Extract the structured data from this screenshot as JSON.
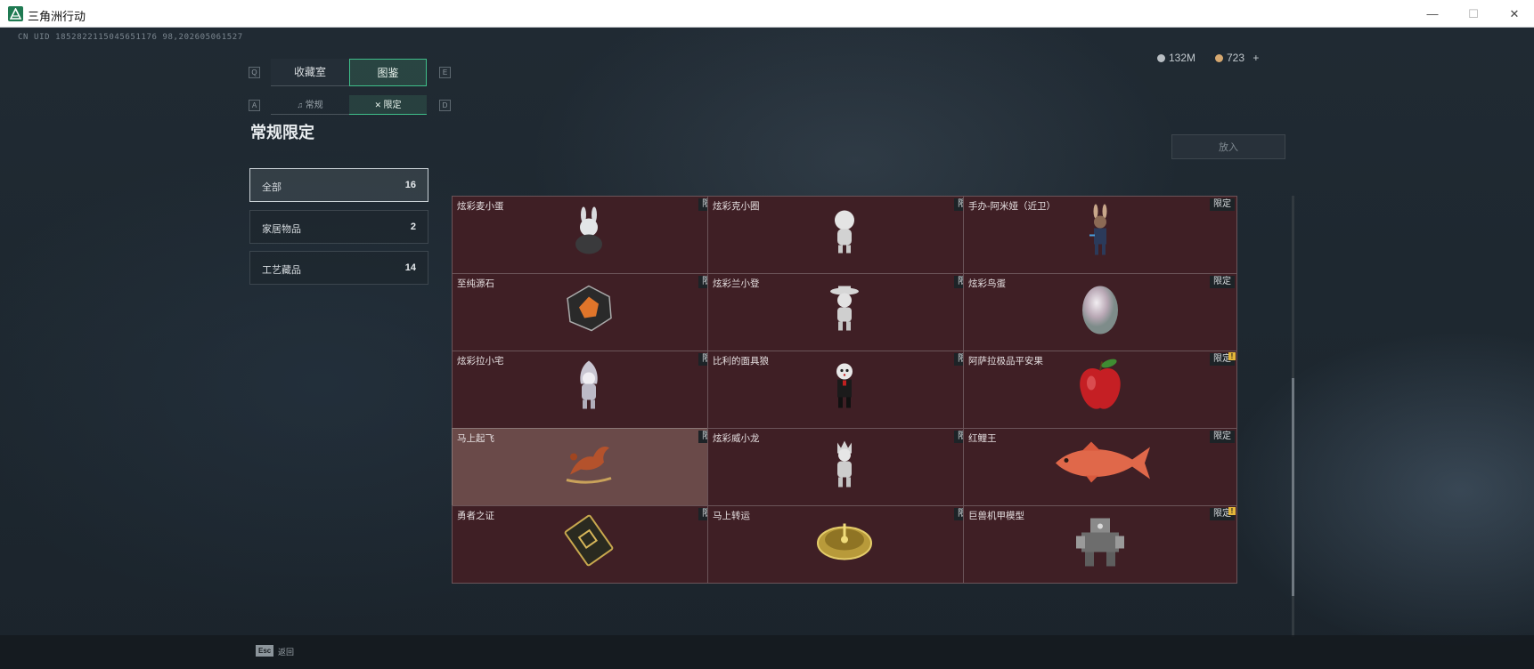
{
  "window": {
    "title": "三角洲行动",
    "minimize": "—",
    "maximize": "☐",
    "close": "✕"
  },
  "uid_text": "CN UID 1852822115045651176 98,202605061527",
  "tabs": {
    "left_key": "Q",
    "right_key": "E",
    "collection": "收藏室",
    "catalog": "图鉴"
  },
  "subtabs": {
    "left_key": "A",
    "right_key": "D",
    "regular": "常规",
    "limited": "限定"
  },
  "section_title": "常规限定",
  "categories": [
    {
      "label": "全部",
      "count": "16"
    },
    {
      "label": "家居物品",
      "count": "2"
    },
    {
      "label": "工艺藏品",
      "count": "14"
    }
  ],
  "currency": {
    "first": "132M",
    "second": "723",
    "add": "+"
  },
  "put_in_button": "放入",
  "limited_tag": "限定",
  "new_mark": "!",
  "items": [
    {
      "name": "炫彩麦小蛋",
      "icon": "rabbit-egg-figure-icon",
      "new": false
    },
    {
      "name": "炫彩克小圈",
      "icon": "girl-figure-icon",
      "new": false
    },
    {
      "name": "手办-阿米娅（近卫）",
      "icon": "amiya-figure-icon",
      "new": false
    },
    {
      "name": "至纯源石",
      "icon": "orange-crystal-icon",
      "new": true
    },
    {
      "name": "炫彩兰小登",
      "icon": "sombrero-figure-icon",
      "new": false
    },
    {
      "name": "炫彩鸟蛋",
      "icon": "egg-icon",
      "new": false
    },
    {
      "name": "炫彩拉小宅",
      "icon": "hooded-figure-icon",
      "new": true
    },
    {
      "name": "比利的面具狼",
      "icon": "puppet-figure-icon",
      "new": true
    },
    {
      "name": "阿萨拉极品平安果",
      "icon": "red-apple-icon",
      "new": true
    },
    {
      "name": "马上起飞",
      "icon": "bronze-horse-icon",
      "new": false
    },
    {
      "name": "炫彩威小龙",
      "icon": "dragon-figure-icon",
      "new": false
    },
    {
      "name": "红鲤王",
      "icon": "red-carp-icon",
      "new": false
    },
    {
      "name": "勇者之证",
      "icon": "gold-card-icon",
      "new": false
    },
    {
      "name": "马上转运",
      "icon": "gold-compass-icon",
      "new": false
    },
    {
      "name": "巨兽机甲模型",
      "icon": "mech-model-icon",
      "new": true
    }
  ],
  "bottom": {
    "esc_key": "Esc",
    "back": "返回"
  },
  "colors": {
    "accent": "#3fbf8a",
    "card_bg": "#3f1f25",
    "card_hover": "#6a4a49"
  }
}
